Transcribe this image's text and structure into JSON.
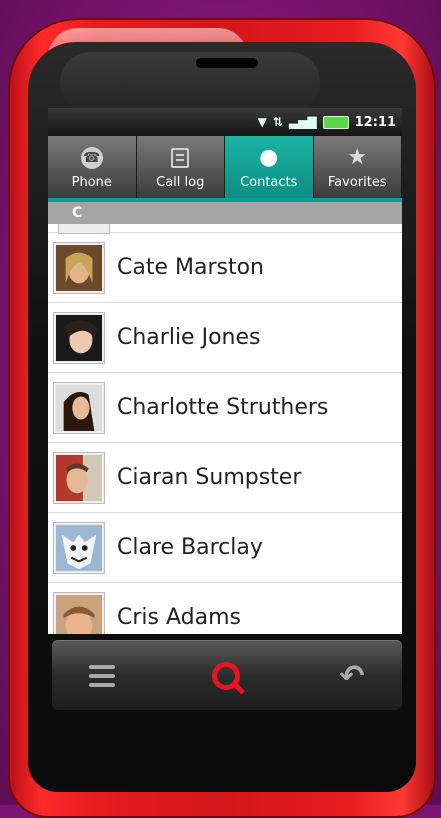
{
  "statusbar": {
    "time": "12:11",
    "wifi_icon": "wifi-icon",
    "signal_icon": "signal-icon",
    "battery_icon": "battery-icon"
  },
  "tabs": [
    {
      "label": "Phone",
      "icon": "phone-icon",
      "active": false
    },
    {
      "label": "Call log",
      "icon": "call-log-icon",
      "active": false
    },
    {
      "label": "Contacts",
      "icon": "contacts-icon",
      "active": true
    },
    {
      "label": "Favorites",
      "icon": "star-icon",
      "active": false
    }
  ],
  "section_header": "C",
  "contacts": [
    {
      "name": "Cate Marston"
    },
    {
      "name": "Charlie Jones"
    },
    {
      "name": "Charlotte Struthers"
    },
    {
      "name": "Ciaran Sumpster"
    },
    {
      "name": "Clare Barclay"
    },
    {
      "name": "Cris Adams"
    }
  ],
  "colors": {
    "phone_body": "#e81c1f",
    "background": "#7d1472",
    "tab_active": "#0a8f83",
    "search_accent": "#e8141e"
  },
  "nav": {
    "menu_icon": "menu-icon",
    "search_icon": "search-icon",
    "back_icon": "back-icon"
  }
}
